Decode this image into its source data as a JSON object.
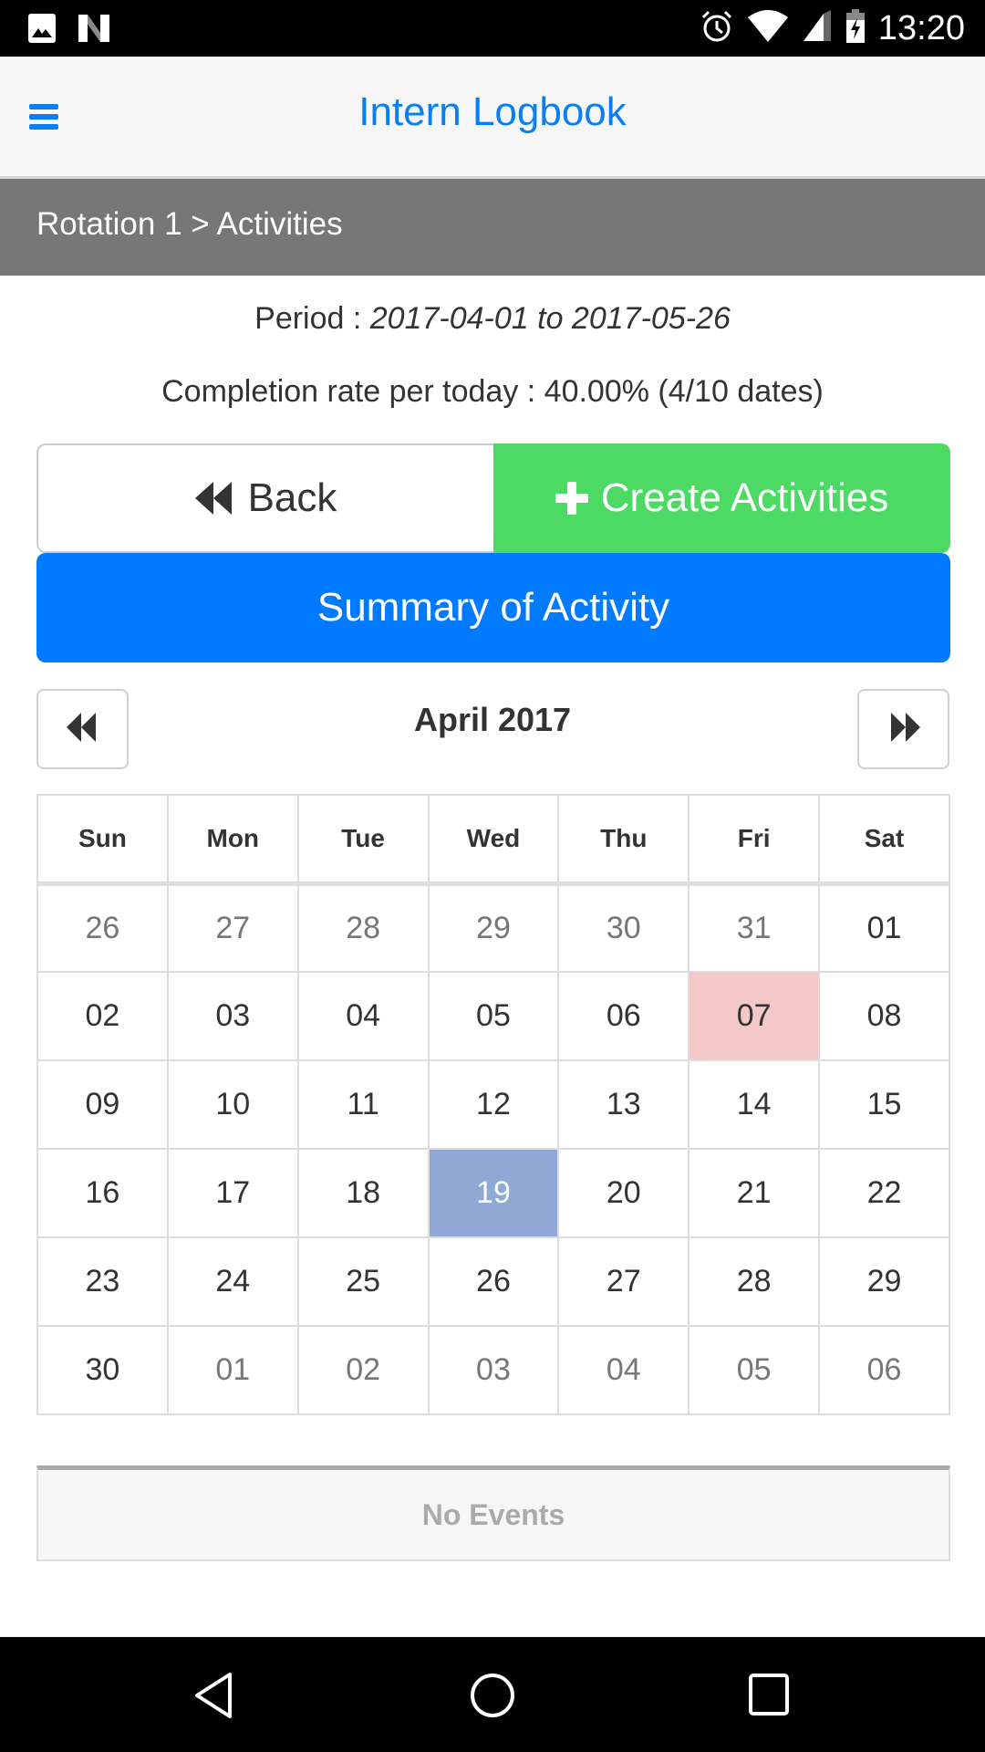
{
  "status_bar": {
    "time": "13:20",
    "left_icons": [
      "image-notification-icon",
      "n-notification-icon"
    ],
    "right_icons": [
      "alarm-icon",
      "wifi-icon",
      "cell-signal-icon",
      "battery-charging-icon"
    ]
  },
  "header": {
    "title": "Intern Logbook",
    "menu_icon": "hamburger-menu-icon",
    "accent_color": "#0a7ff5"
  },
  "breadcrumb": {
    "text": "Rotation 1 > Activities"
  },
  "info": {
    "period_label": "Period : ",
    "period_value": "2017-04-01 to 2017-05-26",
    "completion_text": "Completion rate per today : 40.00% (4/10 dates)"
  },
  "actions": {
    "back_label": "Back",
    "back_icon": "double-chevron-left-icon",
    "create_label": "Create Activities",
    "create_icon": "plus-icon",
    "create_color": "#4cd964",
    "summary_label": "Summary of Activity",
    "summary_color": "#007aff"
  },
  "calendar": {
    "month_label": "April 2017",
    "prev_icon": "backward-icon",
    "next_icon": "forward-icon",
    "weekdays": [
      "Sun",
      "Mon",
      "Tue",
      "Wed",
      "Thu",
      "Fri",
      "Sat"
    ],
    "weeks": [
      [
        {
          "d": "26",
          "s": "other"
        },
        {
          "d": "27",
          "s": "other"
        },
        {
          "d": "28",
          "s": "other"
        },
        {
          "d": "29",
          "s": "other"
        },
        {
          "d": "30",
          "s": "other"
        },
        {
          "d": "31",
          "s": "other"
        },
        {
          "d": "01",
          "s": ""
        }
      ],
      [
        {
          "d": "02",
          "s": ""
        },
        {
          "d": "03",
          "s": ""
        },
        {
          "d": "04",
          "s": ""
        },
        {
          "d": "05",
          "s": ""
        },
        {
          "d": "06",
          "s": ""
        },
        {
          "d": "07",
          "s": "absent"
        },
        {
          "d": "08",
          "s": ""
        }
      ],
      [
        {
          "d": "09",
          "s": ""
        },
        {
          "d": "10",
          "s": ""
        },
        {
          "d": "11",
          "s": ""
        },
        {
          "d": "12",
          "s": ""
        },
        {
          "d": "13",
          "s": ""
        },
        {
          "d": "14",
          "s": ""
        },
        {
          "d": "15",
          "s": ""
        }
      ],
      [
        {
          "d": "16",
          "s": ""
        },
        {
          "d": "17",
          "s": ""
        },
        {
          "d": "18",
          "s": ""
        },
        {
          "d": "19",
          "s": "today"
        },
        {
          "d": "20",
          "s": ""
        },
        {
          "d": "21",
          "s": ""
        },
        {
          "d": "22",
          "s": ""
        }
      ],
      [
        {
          "d": "23",
          "s": ""
        },
        {
          "d": "24",
          "s": ""
        },
        {
          "d": "25",
          "s": ""
        },
        {
          "d": "26",
          "s": ""
        },
        {
          "d": "27",
          "s": ""
        },
        {
          "d": "28",
          "s": ""
        },
        {
          "d": "29",
          "s": ""
        }
      ],
      [
        {
          "d": "30",
          "s": ""
        },
        {
          "d": "01",
          "s": "other"
        },
        {
          "d": "02",
          "s": "other"
        },
        {
          "d": "03",
          "s": "other"
        },
        {
          "d": "04",
          "s": "other"
        },
        {
          "d": "05",
          "s": "other"
        },
        {
          "d": "06",
          "s": "other"
        }
      ]
    ],
    "highlight_colors": {
      "absent": "#f5c8c8",
      "today": "#8fa8d4"
    }
  },
  "events": {
    "empty_text": "No Events"
  },
  "system_nav": {
    "buttons": [
      "back-nav-icon",
      "home-nav-icon",
      "recents-nav-icon"
    ]
  }
}
